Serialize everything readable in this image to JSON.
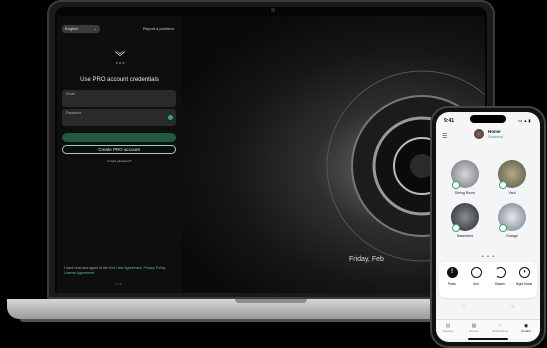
{
  "laptop": {
    "language": "English",
    "report_problem": "Report a problem",
    "pro_label": "PRO",
    "heading": "Use PRO account credentials",
    "email_label": "Email",
    "password_label": "Password",
    "login_label": "",
    "create_label": "Create PRO account",
    "forgot_label": "Forgot password?",
    "agreement_prefix": "I have read and agree to the",
    "agreement_link1": "End User Agreement",
    "agreement_mid": ",",
    "agreement_link2": "Privacy Policy",
    "agreement_link3": "License Agreement",
    "version": "v 4.0",
    "date_text": "Friday, Feb"
  },
  "phone": {
    "time": "9:41",
    "status_icons": "••• ▲ ▮",
    "hub_name": "Home",
    "hub_state": "Disarmed",
    "rooms": [
      {
        "label": "Dining Room",
        "color": "#9aa0a6"
      },
      {
        "label": "Yard",
        "color": "#7d8c6b"
      },
      {
        "label": "Basement",
        "color": "#3d4147"
      },
      {
        "label": "Garage",
        "color": "#a9b4c0"
      }
    ],
    "pager": "• • •",
    "modes": [
      {
        "label": "Panic",
        "glyph": "!",
        "filled": true
      },
      {
        "label": "Arm",
        "glyph": "",
        "filled": false
      },
      {
        "label": "Disarm",
        "glyph": "",
        "filled": false
      },
      {
        "label": "Night Mode",
        "glyph": "◑",
        "filled": false
      }
    ],
    "tabs": [
      {
        "label": "Devices",
        "icon": "▤"
      },
      {
        "label": "Rooms",
        "icon": "▦"
      },
      {
        "label": "Notifications",
        "icon": "□"
      },
      {
        "label": "Control",
        "icon": "◉"
      }
    ]
  }
}
